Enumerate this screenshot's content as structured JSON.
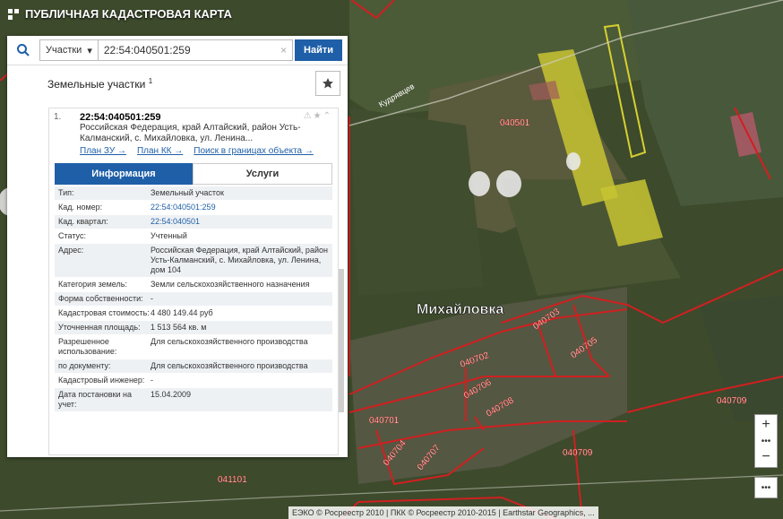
{
  "header": {
    "title": "ПУБЛИЧНАЯ КАДАСТРОВАЯ КАРТА"
  },
  "search": {
    "type_label": "Участки",
    "query": "22:54:040501:259",
    "clear": "×",
    "button": "Найти"
  },
  "panel": {
    "title": "Земельные участки",
    "count_sup": "1"
  },
  "result": {
    "index": "1.",
    "cad_number": "22:54:040501:259",
    "address": "Российская Федерация, край Алтайский, район Усть-Калманский, с. Михайловка, ул. Ленина...",
    "links": [
      "План ЗУ →",
      "План КК →",
      "Поиск в границах объекта →"
    ],
    "tabs": {
      "info": "Информация",
      "services": "Услуги"
    },
    "rows": [
      {
        "k": "Тип:",
        "v": "Земельный участок"
      },
      {
        "k": "Кад. номер:",
        "v": "22:54:040501:259"
      },
      {
        "k": "Кад. квартал:",
        "v": "22:54:040501"
      },
      {
        "k": "Статус:",
        "v": "Учтенный"
      },
      {
        "k": "Адрес:",
        "v": "Российская Федерация, край Алтайский, район Усть-Калманский, с. Михайловка, ул. Ленина, дом 104"
      },
      {
        "k": "Категория земель:",
        "v": "Земли сельскохозяйственного назначения"
      },
      {
        "k": "Форма собственности:",
        "v": "-"
      },
      {
        "k": "Кадастровая стоимость:",
        "v": "4 480 149.44 руб"
      },
      {
        "k": "Уточненная площадь:",
        "v": "1 513 564 кв. м"
      },
      {
        "k": "Разрешенное использование:",
        "v": "Для сельскохозяйственного производства"
      },
      {
        "k": "по документу:",
        "v": "Для сельскохозяйственного производства"
      },
      {
        "k": "Кадастровый инженер:",
        "v": "-"
      },
      {
        "k": "Дата постановки на учет:",
        "v": "15.04.2009"
      }
    ]
  },
  "map": {
    "town": "Михайловка",
    "road": "Кудрявцев",
    "labels": [
      "040501",
      "040703",
      "040702",
      "040705",
      "040706",
      "040705",
      "040708",
      "040701",
      "040704",
      "040707",
      "040709",
      "040709",
      "041101",
      "04"
    ]
  },
  "zoom": {
    "plus": "+",
    "minus": "−",
    "dots": "•••"
  },
  "attribution": "ЕЭКО © Росреестр 2010 | ПКК © Росреестр 2010-2015 | Earthstar Geographics, ..."
}
